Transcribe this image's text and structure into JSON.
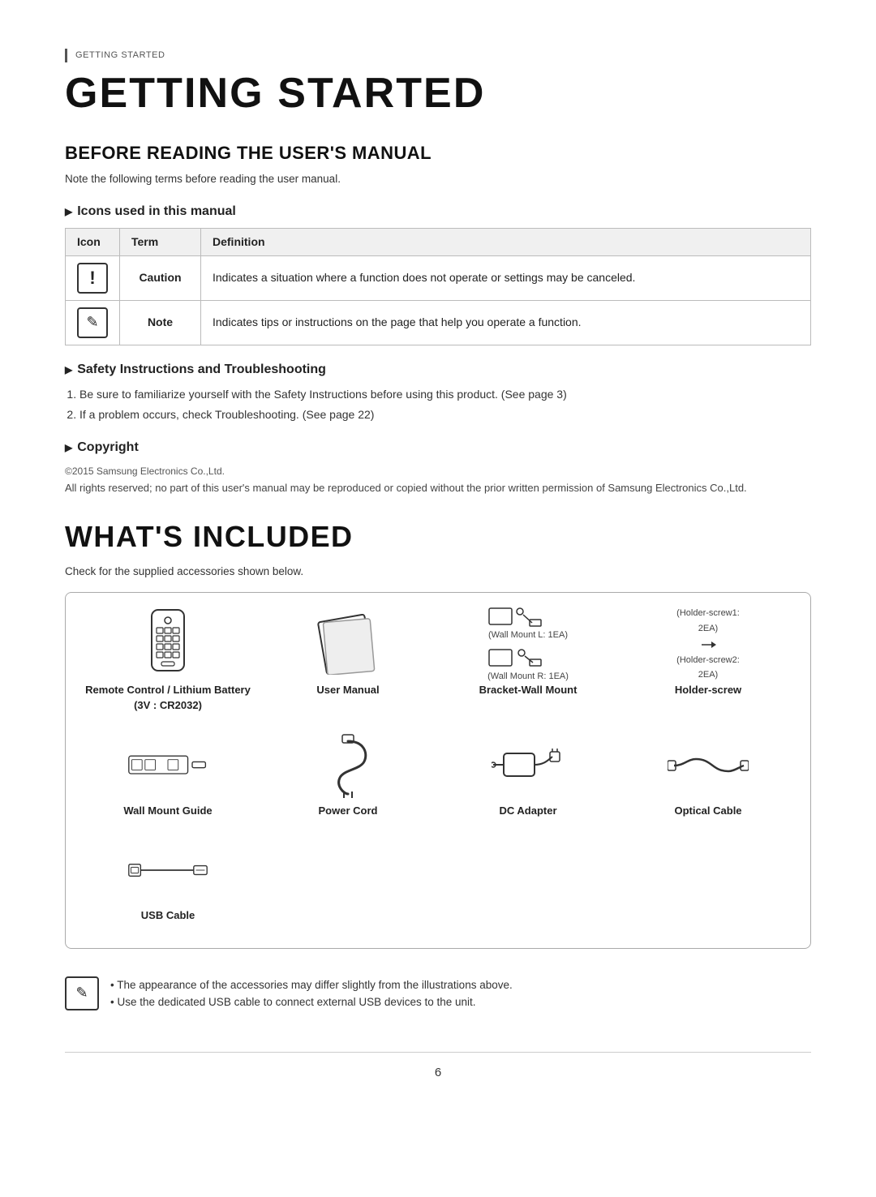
{
  "breadcrumb": "Getting Started",
  "main_title": "GETTING STARTED",
  "section1": {
    "title": "BEFORE READING THE USER'S MANUAL",
    "note": "Note the following terms before reading the user manual.",
    "icons_section": {
      "title": "Icons used in this manual",
      "table_headers": [
        "Icon",
        "Term",
        "Definition"
      ],
      "rows": [
        {
          "icon": "!",
          "term": "Caution",
          "definition": "Indicates a situation where a function does not operate or settings may be canceled."
        },
        {
          "icon": "✎",
          "term": "Note",
          "definition": "Indicates tips or instructions on the page that help you operate a function."
        }
      ]
    },
    "safety_section": {
      "title": "Safety Instructions and Troubleshooting",
      "items": [
        "Be sure to familiarize yourself with the Safety Instructions before using this product. (See page 3)",
        "If a problem occurs, check Troubleshooting. (See page 22)"
      ]
    },
    "copyright_section": {
      "title": "Copyright",
      "copyright_line": "©2015 Samsung Electronics Co.,Ltd.",
      "text": "All rights reserved; no part of this user's manual may be reproduced or copied without the prior written permission of Samsung Electronics Co.,Ltd."
    }
  },
  "section2": {
    "title": "WHAT'S INCLUDED",
    "note": "Check for the supplied accessories shown below.",
    "accessories": [
      {
        "id": "remote-control",
        "label": "Remote Control / Lithium Battery (3V : CR2032)",
        "sublabel": ""
      },
      {
        "id": "user-manual",
        "label": "User Manual",
        "sublabel": ""
      },
      {
        "id": "bracket-wall-mount",
        "label": "Bracket-Wall Mount",
        "sublabel": ""
      },
      {
        "id": "holder-screw",
        "label": "Holder-screw",
        "sublabel": ""
      },
      {
        "id": "wall-mount-guide",
        "label": "Wall Mount Guide",
        "sublabel": ""
      },
      {
        "id": "power-cord",
        "label": "Power Cord",
        "sublabel": ""
      },
      {
        "id": "dc-adapter",
        "label": "DC Adapter",
        "sublabel": ""
      },
      {
        "id": "optical-cable",
        "label": "Optical Cable",
        "sublabel": ""
      },
      {
        "id": "usb-cable",
        "label": "USB Cable",
        "sublabel": ""
      }
    ],
    "wall_mount_labels": [
      "(Wall Mount L: 1EA)",
      "(Wall Mount R: 1EA)"
    ],
    "holder_labels": [
      "(Holder-screw1: 2EA)",
      "(Holder-screw2: 2EA)"
    ],
    "notes": [
      "The appearance of the accessories may differ slightly from the illustrations above.",
      "Use the dedicated USB cable to connect external USB devices to the unit."
    ]
  },
  "page_number": "6"
}
